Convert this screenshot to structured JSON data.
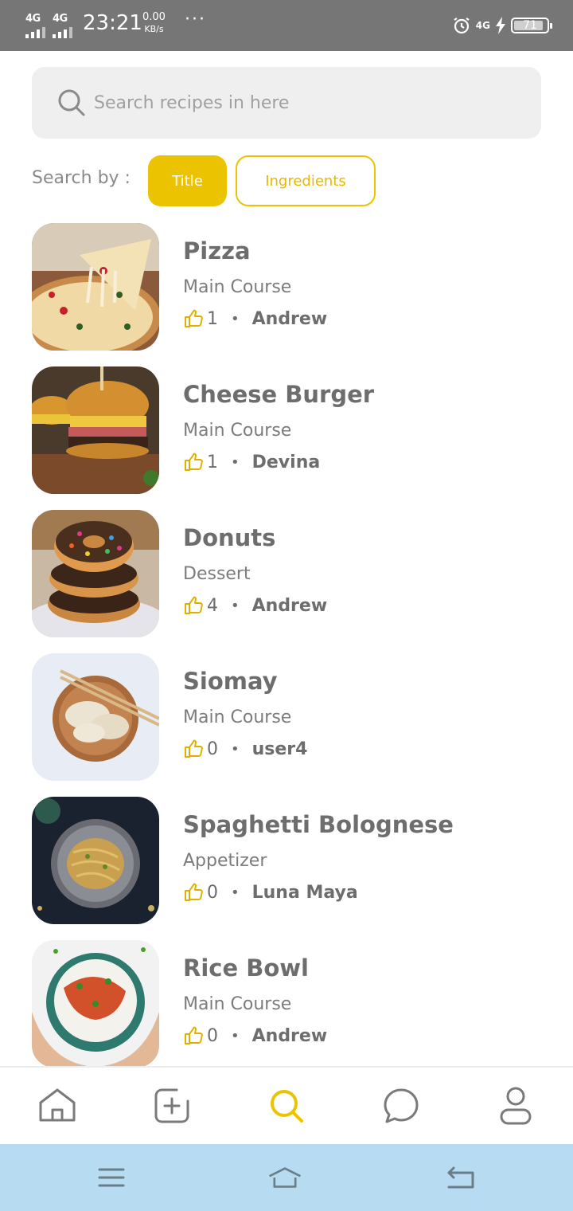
{
  "status_bar": {
    "signal_1": "4G",
    "signal_2": "4G",
    "time": "23:21",
    "speed_value": "0.00",
    "speed_unit": "KB/s",
    "overflow": "···",
    "network_right": "4G",
    "battery": "71",
    "icons": [
      "alarm-icon",
      "charging-icon",
      "battery-icon"
    ]
  },
  "search": {
    "placeholder": "Search recipes in here",
    "value": ""
  },
  "search_by": {
    "label": "Search by :",
    "options": [
      "Title",
      "Ingredients"
    ],
    "selected": "Title"
  },
  "recipes": [
    {
      "name": "Pizza",
      "category": "Main Course",
      "likes": "1",
      "author": "Andrew"
    },
    {
      "name": "Cheese Burger",
      "category": "Main Course",
      "likes": "1",
      "author": "Devina"
    },
    {
      "name": "Donuts",
      "category": "Dessert",
      "likes": "4",
      "author": "Andrew"
    },
    {
      "name": "Siomay",
      "category": "Main Course",
      "likes": "0",
      "author": "user4"
    },
    {
      "name": "Spaghetti Bolognese",
      "category": "Appetizer",
      "likes": "0",
      "author": "Luna Maya"
    },
    {
      "name": "Rice Bowl",
      "category": "Main Course",
      "likes": "0",
      "author": "Andrew"
    }
  ],
  "meta_separator": "•",
  "bottom_nav": {
    "items": [
      "home-icon",
      "add-recipe-icon",
      "search-icon",
      "chat-icon",
      "profile-icon"
    ],
    "active": "search-icon"
  },
  "system_nav": {
    "items": [
      "menu-icon",
      "home-icon",
      "back-icon"
    ]
  },
  "colors": {
    "accent": "#ecc300",
    "status_bar": "#767676",
    "system_nav": "#b7dcf1",
    "text": "#6d6d6d",
    "search_bg": "#efefef"
  }
}
